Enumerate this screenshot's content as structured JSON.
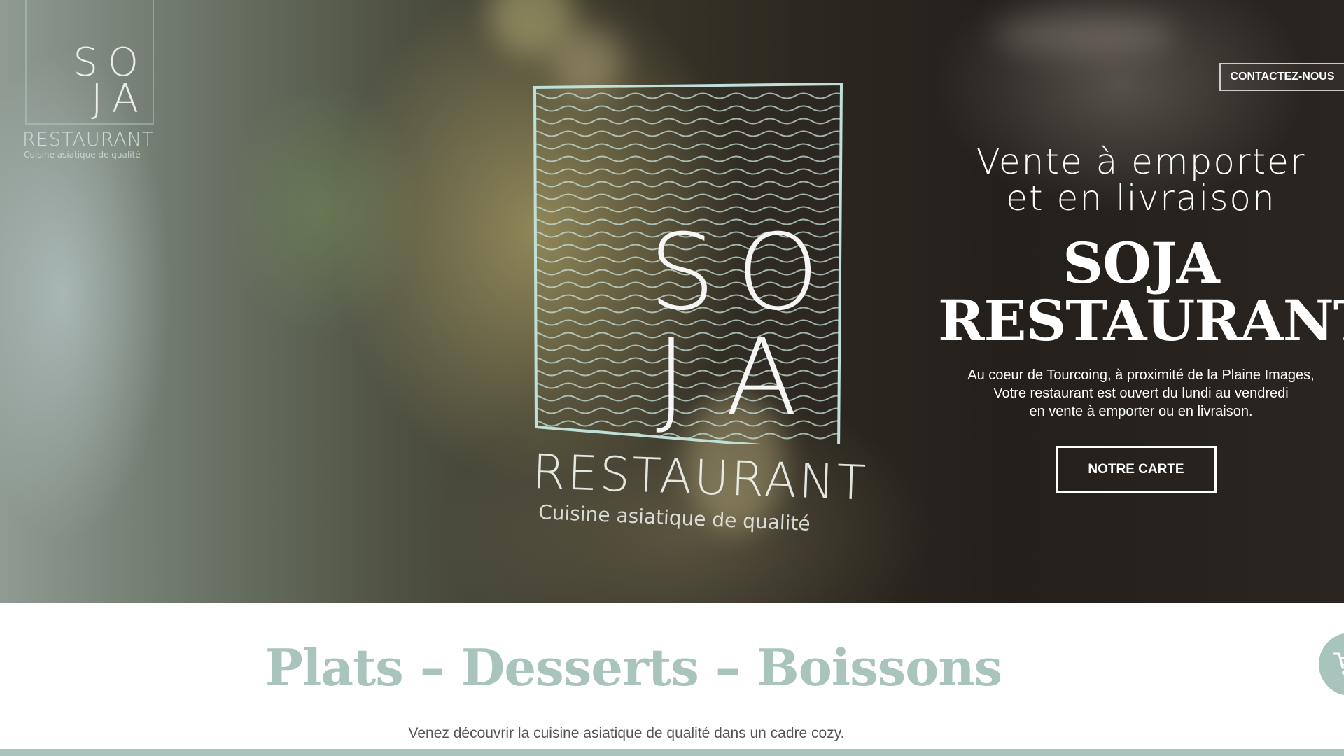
{
  "header": {
    "logo": {
      "line1": "SO",
      "line2": "JA",
      "restaurant": "RESTAURANT",
      "tagline": "Cuisine asiatique de qualité"
    },
    "contact_label": "CONTACTEZ-NOUS"
  },
  "hero": {
    "logo": {
      "line1": "SO",
      "line2": "JA",
      "restaurant": "RESTAURANT",
      "tagline": "Cuisine asiatique de qualité"
    },
    "subtitle_line1": "Vente à emporter",
    "subtitle_line2": "et en livraison",
    "title_line1": "SOJA",
    "title_line2": "RESTAURANT",
    "desc_line1": "Au coeur de Tourcoing, à proximité de la Plaine Images,",
    "desc_line2": "Votre restaurant est ouvert du lundi au vendredi",
    "desc_line3": "en vente à emporter ou en livraison.",
    "cta_label": "NOTRE CARTE"
  },
  "menu_section": {
    "title": "Plats – Desserts – Boissons",
    "description": "Venez découvrir la cuisine asiatique de qualité dans un cadre cozy."
  },
  "icons": {
    "cart": "cart-icon"
  },
  "colors": {
    "accent": "#a9c3bd",
    "logo_line": "#bfe0d8",
    "text_dark": "#555555"
  }
}
